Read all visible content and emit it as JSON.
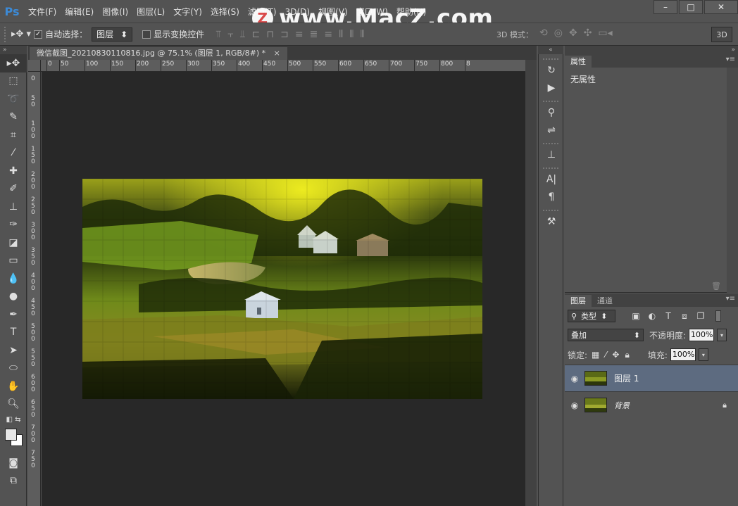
{
  "app": {
    "logo": "Ps",
    "menu": [
      "文件(F)",
      "编辑(E)",
      "图像(I)",
      "图层(L)",
      "文字(Y)",
      "选择(S)",
      "滤镜(T)",
      "3D(D)",
      "视图(V)",
      "窗口(W)",
      "帮助(H)"
    ],
    "window_controls": {
      "minimize": "–",
      "restore": "□",
      "close": "✕"
    },
    "watermark": {
      "badge": "Z",
      "text": "www.MacZ.com"
    }
  },
  "options": {
    "auto_select_label": "自动选择：",
    "auto_select_value": "图层",
    "show_transform_label": "显示变换控件",
    "mode3d_label": "3D 模式：",
    "btn_3d": "3D"
  },
  "document": {
    "tab_title": "微信截图_20210830110816.jpg @ 75.1% (图层 1, RGB/8#) *",
    "tab_close": "×",
    "ruler_h": [
      "0",
      "50",
      "100",
      "150",
      "200",
      "250",
      "300",
      "350",
      "400",
      "450",
      "500",
      "550",
      "600",
      "650",
      "700",
      "750",
      "800",
      "8"
    ],
    "ruler_v": [
      "0",
      "50",
      "100",
      "150",
      "200",
      "250",
      "300",
      "350",
      "400",
      "450",
      "500",
      "550",
      "600",
      "650",
      "700",
      "750"
    ]
  },
  "properties_panel": {
    "tab": "属性",
    "empty_text": "无属性"
  },
  "layers_panel": {
    "tabs": [
      "图层",
      "通道"
    ],
    "filter_type": "类型",
    "blend_mode": "叠加",
    "opacity_label": "不透明度:",
    "opacity_value": "100%",
    "lock_label": "锁定:",
    "fill_label": "填充:",
    "fill_value": "100%",
    "layers": [
      {
        "name": "图层 1",
        "selected": true,
        "locked": false
      },
      {
        "name": "背景",
        "selected": false,
        "locked": true
      }
    ]
  },
  "colors": {
    "ui_bg": "#535353",
    "canvas_bg": "#282828",
    "selection": "#5d6b80",
    "accent": "#3c8ad6"
  }
}
